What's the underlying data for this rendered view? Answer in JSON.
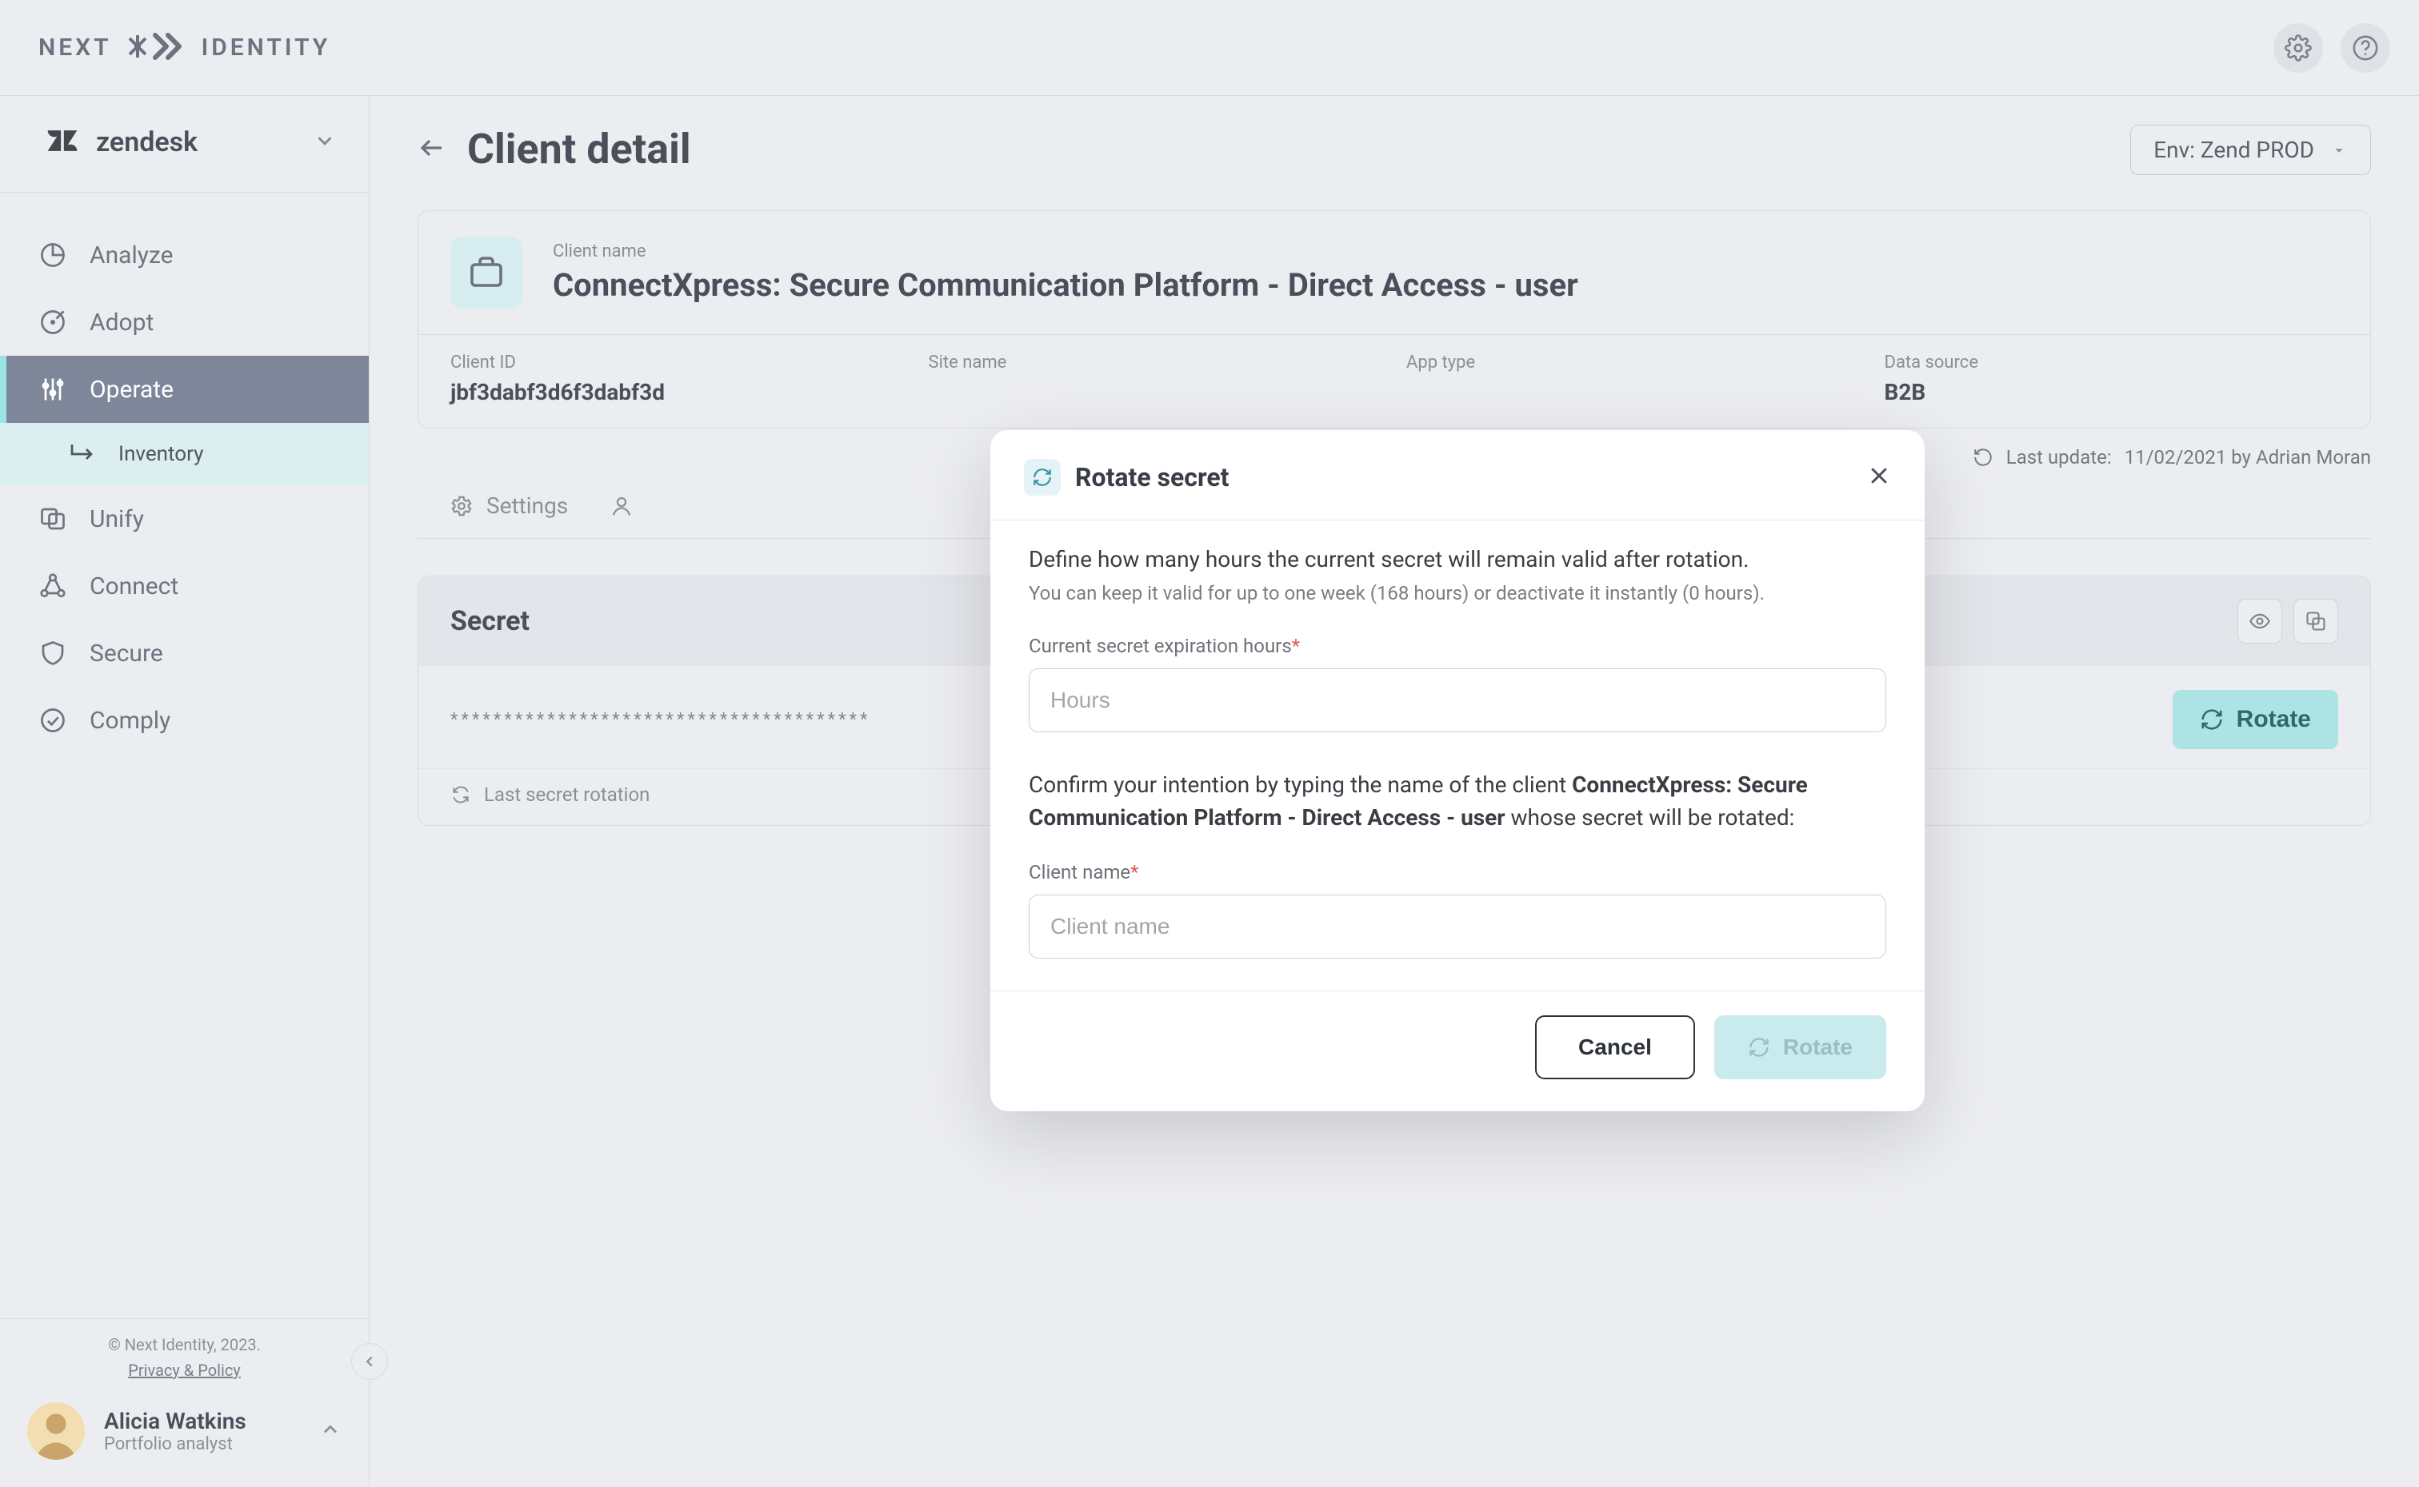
{
  "brand": {
    "left": "NEXT",
    "right": "IDENTITY"
  },
  "tenant": {
    "name": "zendesk"
  },
  "nav": {
    "analyze": "Analyze",
    "adopt": "Adopt",
    "operate": "Operate",
    "inventory": "Inventory",
    "unify": "Unify",
    "connect": "Connect",
    "secure": "Secure",
    "comply": "Comply"
  },
  "footer": {
    "copyright": "© Next Identity, 2023.",
    "privacy": "Privacy & Policy"
  },
  "user": {
    "name": "Alicia Watkins",
    "role": "Portfolio analyst"
  },
  "page": {
    "title": "Client detail"
  },
  "env": {
    "label": "Env: Zend PROD"
  },
  "client": {
    "name_label": "Client name",
    "name": "ConnectXpress: Secure Communication Platform - Direct Access - user",
    "id_label": "Client ID",
    "id": "jbf3dabf3d6f3dabf3d",
    "site_label": "Site name",
    "app_type_label": "App type",
    "data_source_label": "Data source",
    "data_source": "B2B"
  },
  "meta": {
    "last_update_label": "Last update:",
    "last_update_value": "11/02/2021 by Adrian Moran"
  },
  "tabs": {
    "settings": "Settings"
  },
  "secret": {
    "title": "Secret",
    "mask": "***************************************",
    "rotate": "Rotate",
    "last_rotation_label": "Last secret rotation"
  },
  "modal": {
    "title": "Rotate secret",
    "lead": "Define how many hours the current secret will remain valid after rotation.",
    "sub": "You can keep it valid for up to one week (168 hours) or deactivate it instantly (0 hours).",
    "hours_label": "Current secret expiration hours",
    "hours_placeholder": "Hours",
    "confirm_pre": "Confirm your intention by typing the name of the client ",
    "confirm_name": "ConnectXpress: Secure Communication Platform - Direct Access - user",
    "confirm_post": " whose secret will be rotated:",
    "client_name_label": "Client name",
    "client_name_placeholder": "Client name",
    "cancel": "Cancel",
    "rotate": "Rotate"
  }
}
